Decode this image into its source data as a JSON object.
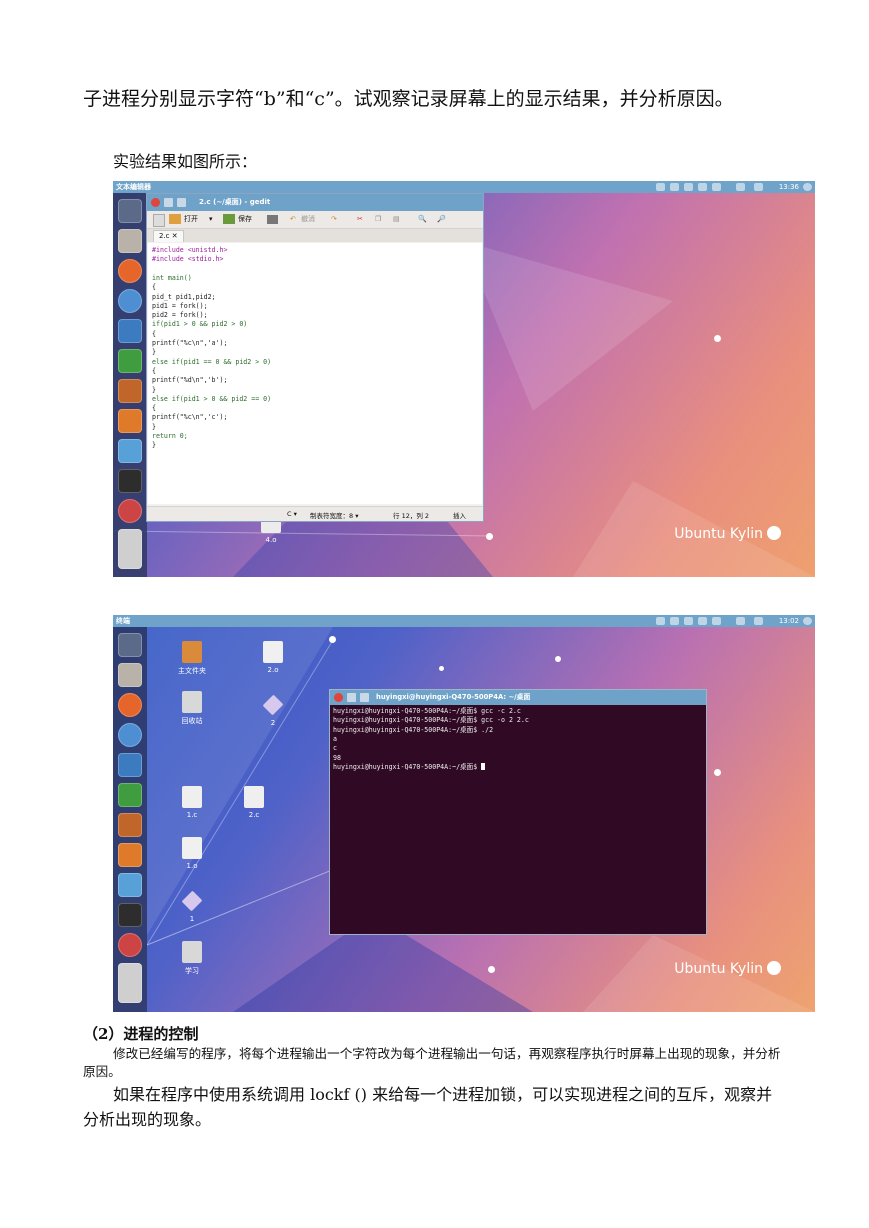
{
  "doc": {
    "para1": "子进程分别显示字符“b”和“c”。试观察记录屏幕上的显示结果，并分析原因。",
    "para2": "实验结果如图所示：",
    "heading": "（2）进程的控制",
    "para3": "修改已经编写的程序，将每个进程输出一个字符改为每个进程输出一句话，再观察程序执行时屏幕上出现的现象，并分析原因。",
    "para4": "如果在程序中使用系统调用 lockf () 来给每一个进程加锁，可以实现进程之间的互斥，观察并分析出现的现象。"
  },
  "shot1": {
    "topbar_title": "文本编辑器",
    "clock": "13:36",
    "window_title": "2.c (~/桌面) - gedit",
    "toolbar": {
      "open": "打开",
      "save": "保存",
      "undo": "撤消"
    },
    "tab": "2.c",
    "code": [
      "#include <unistd.h>",
      "#include <stdio.h>",
      "",
      "int main()",
      "{",
      "pid_t pid1,pid2;",
      "pid1 = fork();",
      "pid2 = fork();",
      "if(pid1 > 0 && pid2 > 0)",
      "{",
      "printf(\"%c\\n\",'a');",
      "}",
      "else if(pid1 == 0 && pid2 > 0)",
      "{",
      "printf(\"%d\\n\",'b');",
      "}",
      "else if(pid1 > 0 && pid2 == 0)",
      "{",
      "printf(\"%c\\n\",'c');",
      "}",
      "return 0;",
      "}"
    ],
    "status": {
      "lang": "C ▾",
      "tab_width": "制表符宽度：8 ▾",
      "position": "行 12，列 2",
      "mode": "插入"
    },
    "desktop_file": "4.o",
    "watermark": "Ubuntu Kylin"
  },
  "shot2": {
    "topbar_title": "终端",
    "clock": "13:02",
    "window_title": "huyingxi@huyingxi-Q470-500P4A: ~/桌面",
    "terminal_lines": [
      "huyingxi@huyingxi-Q470-500P4A:~/桌面$ gcc -c 2.c",
      "huyingxi@huyingxi-Q470-500P4A:~/桌面$ gcc -o 2 2.c",
      "huyingxi@huyingxi-Q470-500P4A:~/桌面$ ./2",
      "a",
      "c",
      "98",
      "huyingxi@huyingxi-Q470-500P4A:~/桌面$ "
    ],
    "desktop_icons": {
      "home": "主文件夹",
      "trash": "回收站",
      "f_2o": "2.o",
      "f_2": "2",
      "f_1c": "1.c",
      "f_2c": "2.c",
      "f_1o": "1.o",
      "f_1": "1",
      "study": "学习"
    },
    "watermark": "Ubuntu Kylin"
  }
}
